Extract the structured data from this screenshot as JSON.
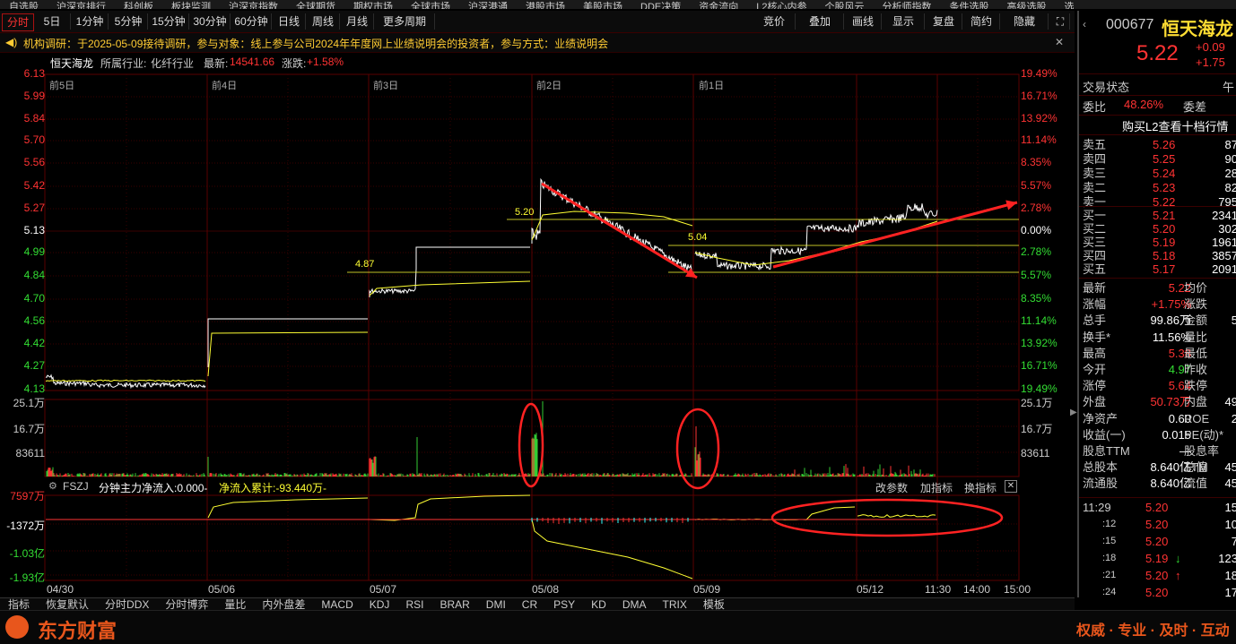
{
  "top_menu": [
    "自选股",
    "沪深京排行",
    "科创板",
    "板块监测",
    "沪深京指数",
    "全球期货",
    "期权市场",
    "全球市场",
    "沪深港通",
    "港股市场",
    "美股市场",
    "DDE决策",
    "资金流向",
    "L2核心内参",
    "个股风云",
    "分析师指数",
    "条件选股",
    "高级选股",
    "选"
  ],
  "period_tabs": [
    "分时",
    "5日",
    "1分钟",
    "5分钟",
    "15分钟",
    "30分钟",
    "60分钟",
    "日线",
    "周线",
    "月线",
    "更多周期"
  ],
  "toolbar_right": [
    "竞价",
    "叠加",
    "画线",
    "显示",
    "复盘",
    "简约",
    "隐藏"
  ],
  "notice": {
    "text": "机构调研：于2025-05-09接待调研，参与对象：线上参与公司2024年年度网上业绩说明会的投资者，参与方式：业绩说明会",
    "close": "✕"
  },
  "header": {
    "name": "恒天海龙",
    "industry_label": "所属行业:",
    "industry": "化纤行业",
    "latest_label": "最新:",
    "latest": "14541.66",
    "change_label": "涨跌:",
    "change": "+1.58%"
  },
  "price_axis_left": [
    "6.13",
    "5.99",
    "5.84",
    "5.70",
    "5.56",
    "5.42",
    "5.27",
    "5.13",
    "4.99",
    "4.84",
    "4.70",
    "4.56",
    "4.42",
    "4.27",
    "4.13"
  ],
  "price_axis_right": [
    "19.49%",
    "16.71%",
    "13.92%",
    "11.14%",
    "8.35%",
    "5.57%",
    "2.78%",
    "0.00%",
    "2.78%",
    "5.57%",
    "8.35%",
    "11.14%",
    "13.92%",
    "16.71%",
    "19.49%"
  ],
  "day_labels": [
    "前5日",
    "前4日",
    "前3日",
    "前2日",
    "前1日"
  ],
  "price_annotations": [
    "4.87",
    "5.20",
    "5.04"
  ],
  "volume_axis": [
    "25.1万",
    "16.7万",
    "83611"
  ],
  "indicator": {
    "name": "FSZJ",
    "net_inflow_label": "分钟主力净流入:0.000-",
    "cumulative_label": "净流入累计:-93.440万-",
    "buttons": [
      "改参数",
      "加指标",
      "换指标"
    ],
    "axis": [
      "7597万",
      "-1372万",
      "-1.03亿",
      "-1.93亿"
    ]
  },
  "time_axis": [
    "04/30",
    "05/06",
    "05/07",
    "05/08",
    "05/09",
    "05/12",
    "11:30",
    "14:00",
    "15:00"
  ],
  "bottom_tabs": [
    "指标",
    "恢复默认",
    "分时DDX",
    "分时博弈",
    "量比",
    "内外盘差",
    "MACD",
    "KDJ",
    "RSI",
    "BRAR",
    "DMI",
    "CR",
    "PSY",
    "KD",
    "DMA",
    "TRIX",
    "模板"
  ],
  "quote": {
    "code": "000677",
    "name": "恒天海龙",
    "price": "5.22",
    "change": "+0.09",
    "change_pct": "+1.75",
    "status_label": "交易状态",
    "status_value": "午",
    "weibi_label": "委比",
    "weibi": "48.26%",
    "weicha_label": "委差",
    "l2_link": "购买L2查看十档行情",
    "sell": [
      {
        "label": "卖五",
        "price": "5.26",
        "qty": "87"
      },
      {
        "label": "卖四",
        "price": "5.25",
        "qty": "90"
      },
      {
        "label": "卖三",
        "price": "5.24",
        "qty": "28"
      },
      {
        "label": "卖二",
        "price": "5.23",
        "qty": "82"
      },
      {
        "label": "卖一",
        "price": "5.22",
        "qty": "795"
      }
    ],
    "buy": [
      {
        "label": "买一",
        "price": "5.21",
        "qty": "2341"
      },
      {
        "label": "买二",
        "price": "5.20",
        "qty": "302"
      },
      {
        "label": "买三",
        "price": "5.19",
        "qty": "1961"
      },
      {
        "label": "买四",
        "price": "5.18",
        "qty": "3857"
      },
      {
        "label": "买五",
        "price": "5.17",
        "qty": "2091"
      }
    ],
    "stats": [
      {
        "k": "最新",
        "v": "5.22",
        "vc": "red",
        "k2": "均价",
        "v2": ""
      },
      {
        "k": "涨幅",
        "v": "+1.75%",
        "vc": "red",
        "k2": "涨跌",
        "v2": ""
      },
      {
        "k": "总手",
        "v": "99.86万",
        "vc": "wht",
        "k2": "金额",
        "v2": "5"
      },
      {
        "k": "换手*",
        "v": "11.56%",
        "vc": "wht",
        "k2": "量比",
        "v2": ""
      },
      {
        "k": "最高",
        "v": "5.38",
        "vc": "red",
        "k2": "最低",
        "v2": ""
      },
      {
        "k": "今开",
        "v": "4.97",
        "vc": "grn",
        "k2": "昨收",
        "v2": ""
      },
      {
        "k": "涨停",
        "v": "5.64",
        "vc": "red",
        "k2": "跌停",
        "v2": ""
      },
      {
        "k": "外盘",
        "v": "50.73万",
        "vc": "red",
        "k2": "内盘",
        "v2": "49"
      },
      {
        "k": "净资产",
        "v": "0.60",
        "vc": "wht",
        "k2": "ROE",
        "v2": "2"
      },
      {
        "k": "收益(一)",
        "v": "0.015",
        "vc": "wht",
        "k2": "PE(动)*",
        "v2": ""
      },
      {
        "k": "股息TTM",
        "v": "—",
        "vc": "wht",
        "k2": "股息率TTM",
        "v2": ""
      },
      {
        "k": "总股本",
        "v": "8.640亿",
        "vc": "wht",
        "k2": "总值",
        "v2": "45"
      },
      {
        "k": "流通股",
        "v": "8.640亿",
        "vc": "wht",
        "k2": "流值",
        "v2": "45"
      }
    ],
    "ticks": [
      {
        "t": "11:29",
        "p": "5.20",
        "pc": "red",
        "q": "15",
        "arrow": ""
      },
      {
        "t": ":12",
        "p": "5.20",
        "pc": "red",
        "q": "10",
        "arrow": ""
      },
      {
        "t": ":15",
        "p": "5.20",
        "pc": "red",
        "q": "7",
        "arrow": ""
      },
      {
        "t": ":18",
        "p": "5.19",
        "pc": "red",
        "q": "123",
        "arrow": "↓"
      },
      {
        "t": ":21",
        "p": "5.20",
        "pc": "red",
        "q": "18",
        "arrow": "↑"
      },
      {
        "t": ":24",
        "p": "5.20",
        "pc": "red",
        "q": "17",
        "arrow": ""
      }
    ]
  },
  "footer": {
    "logo": "东方财富",
    "slogan": "权威 · 专业 · 及时 · 互动"
  },
  "colors": {
    "up": "#ff3333",
    "down": "#33dd33",
    "price_line": "#ffffff",
    "avg_line": "#ffff33",
    "annotation": "#ff3333",
    "bg": "#000000"
  }
}
